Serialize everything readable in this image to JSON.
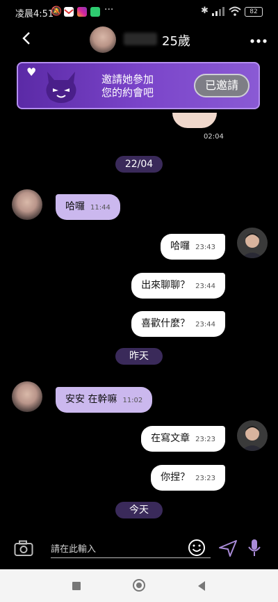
{
  "status_bar": {
    "time": "凌晨4:51",
    "battery": "82",
    "more": "···"
  },
  "header": {
    "age": "25歲",
    "back_icon": "chevron-left-icon",
    "more_icon": "more-horizontal-icon"
  },
  "banner": {
    "line1": "邀請她參加",
    "line2": "您的約會吧",
    "button": "已邀請"
  },
  "image_message": {
    "time": "02:04"
  },
  "date_pills": {
    "d1": "22/04",
    "d2": "昨天",
    "d3": "今天"
  },
  "messages": [
    {
      "side": "in",
      "text": "哈囉",
      "time": "11:44"
    },
    {
      "side": "out",
      "text": "哈囉",
      "time": "23:43"
    },
    {
      "side": "out",
      "text": "出來聊聊？",
      "time": "23:44"
    },
    {
      "side": "out",
      "text": "喜歡什麼？",
      "time": "23:44"
    },
    {
      "side": "in",
      "text": "安安 在幹嘛",
      "time": "11:02"
    },
    {
      "side": "out",
      "text": "在寫文章",
      "time": "23:23"
    },
    {
      "side": "out",
      "text": "你捏？",
      "time": "23:23"
    }
  ],
  "input": {
    "placeholder": "請在此輸入"
  },
  "colors": {
    "accent": "#8a5ad4",
    "bubble_in": "#cbb8ee",
    "bubble_out": "#ffffff",
    "pill": "#3a2a5a"
  }
}
